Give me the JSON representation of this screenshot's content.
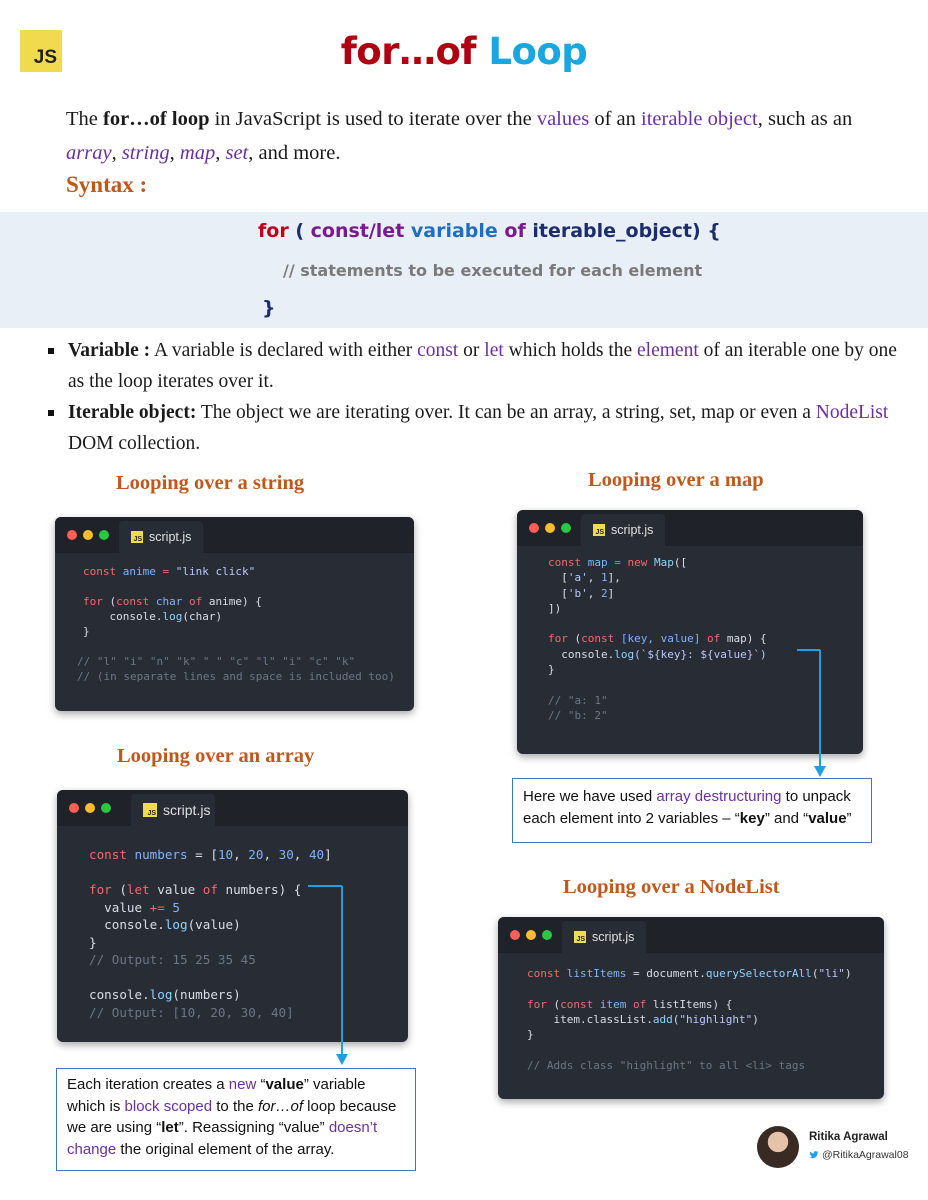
{
  "header": {
    "logo_text": "JS",
    "title_part1": "for…of",
    "title_part2": "Loop"
  },
  "intro": {
    "p1": "The ",
    "p2": "for…of loop",
    "p3": " in JavaScript is used to iterate over the ",
    "p4": "values",
    "p5": " of an ",
    "p6": "iterable object",
    "p7": ", such as an ",
    "p8": "array",
    "p9": ", ",
    "p10": "string",
    "p11": ", ",
    "p12": "map",
    "p13": ", ",
    "p14": "set",
    "p15": ", and more."
  },
  "syntax": {
    "heading": "Syntax :",
    "kw_for": "for",
    "open_paren": " ( ",
    "kw_const_let": "const/let",
    "kw_variable": " variable",
    "kw_of": " of ",
    "iterable": " iterable_object) {",
    "comment": "// statements to be executed for each element",
    "close": "}"
  },
  "bullets": [
    {
      "term": "Variable :",
      "t1": " A variable is declared with either ",
      "h1": "const",
      "t2": " or ",
      "h2": "let",
      "t3": " which holds the ",
      "h3": "element",
      "t4": " of an iterable one by one as the loop iterates over it."
    },
    {
      "term": "Iterable object:",
      "t1": " The object we are iterating over. It can be an array, a string, set, map or even a ",
      "h1": "NodeList",
      "t2": " DOM collection."
    }
  ],
  "sections": {
    "string": "Looping over a string",
    "array": "Looping over an array",
    "map": "Looping over a map",
    "nodelist": "Looping over a NodeList"
  },
  "tab_name": "script.js",
  "tab_logo": "JS",
  "code_string": {
    "l1a": "const",
    "l1b": " anime",
    "l1c": " = ",
    "l1d": "\"link click\"",
    "l3a": "for",
    "l3b": " (",
    "l3c": "const",
    "l3d": " char",
    "l3e": " of",
    "l3f": " anime) {",
    "l4a": "    console.",
    "l4b": "log",
    "l4c": "(char)",
    "l5": "}",
    "l7": "// \"l\" \"i\" \"n\" \"k\" \" \" \"c\" \"l\" \"i\" \"c\" \"k\"",
    "l8": "// (in separate lines and space is included too)"
  },
  "code_array": {
    "l1a": "const",
    "l1b": " numbers",
    "l1c": " = [",
    "l1d": "10",
    "l1e": ", ",
    "l1f": "20",
    "l1g": ", ",
    "l1h": "30",
    "l1i": ", ",
    "l1j": "40",
    "l1k": "]",
    "l3a": "for",
    "l3b": " (",
    "l3c": "let",
    "l3d": " value",
    "l3e": " of",
    "l3f": " numbers) {",
    "l4a": "  value",
    "l4b": " +=",
    "l4c": " 5",
    "l5a": "  console.",
    "l5b": "log",
    "l5c": "(value)",
    "l6": "}",
    "l7": "// Output: 15 25 35 45",
    "l9a": "console.",
    "l9b": "log",
    "l9c": "(numbers)",
    "l10": "// Output: [10, 20, 30, 40]"
  },
  "code_map": {
    "l1a": "const",
    "l1b": " map",
    "l1c": " = ",
    "l1d": "new",
    "l1e": " Map",
    "l1f": "([",
    "l2a": "  [",
    "l2b": "'a'",
    "l2c": ", ",
    "l2d": "1",
    "l2e": "],",
    "l3a": "  [",
    "l3b": "'b'",
    "l3c": ", ",
    "l3d": "2",
    "l3e": "]",
    "l4": "])",
    "l6a": "for",
    "l6b": " (",
    "l6c": "const",
    "l6d": " [key, value]",
    "l6e": " of",
    "l6f": " map) {",
    "l7a": "  console.",
    "l7b": "log",
    "l7c": "(`${key}: ${value}`)",
    "l8": "}",
    "l10": "// \"a: 1\"",
    "l11": "// \"b: 2\""
  },
  "code_nodelist": {
    "l1a": "const",
    "l1b": " listItems",
    "l1c": " = document.",
    "l1d": "querySelectorAll",
    "l1e": "(",
    "l1f": "\"li\"",
    "l1g": ")",
    "l3a": "for",
    "l3b": " (",
    "l3c": "const",
    "l3d": " item",
    "l3e": " of",
    "l3f": " listItems) {",
    "l4a": "    item.classList.",
    "l4b": "add",
    "l4c": "(",
    "l4d": "\"highlight\"",
    "l4e": ")",
    "l5": "}",
    "l7": "// Adds class \"highlight\" to all <li> tags"
  },
  "callout_map": {
    "a": "Here we have used ",
    "b": "array destructuring",
    "c": " to unpack each element into 2 variables – “",
    "d": "key",
    "e": "” and “",
    "f": "value",
    "g": "”"
  },
  "callout_array": {
    "a": "Each iteration creates a ",
    "b": "new",
    "c": " “",
    "d": "value",
    "e": "” variable which is ",
    "f": "block scoped",
    "g": " to the ",
    "h": "for…of",
    "i": " loop because we are using “",
    "j": "let",
    "k": "”. Reassigning “value” ",
    "l": "doesn’t change",
    "m": " the original element of the array."
  },
  "author": {
    "name": "Ritika Agrawal",
    "handle": "@RitikaAgrawal08"
  },
  "colors": {
    "title_red": "#b00010",
    "title_blue": "#1aa6e0",
    "heading_orange": "#c0581c",
    "highlight_purple": "#6b2fa0",
    "code_bg": "#282c34",
    "syntax_bg": "#e9eff7",
    "arrow_blue": "#1ea0e0"
  }
}
